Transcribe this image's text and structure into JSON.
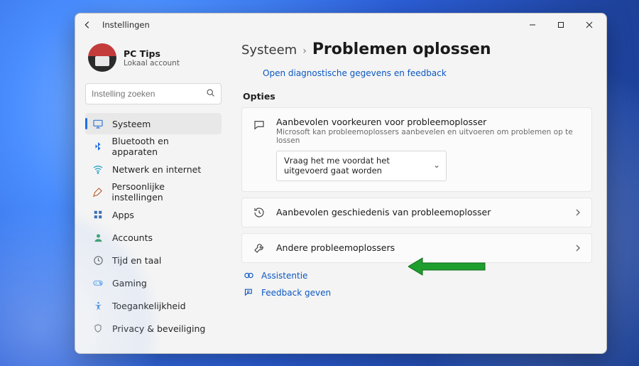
{
  "window": {
    "title": "Instellingen"
  },
  "profile": {
    "name": "PC Tips",
    "sub": "Lokaal account"
  },
  "search": {
    "placeholder": "Instelling zoeken"
  },
  "sidebar": {
    "items": [
      {
        "label": "Systeem",
        "icon": "system-icon",
        "color": "#3478d6",
        "active": true
      },
      {
        "label": "Bluetooth en apparaten",
        "icon": "bluetooth-icon",
        "color": "#1f6fe0"
      },
      {
        "label": "Netwerk en internet",
        "icon": "wifi-icon",
        "color": "#2aa3c9"
      },
      {
        "label": "Persoonlijke instellingen",
        "icon": "personalize-icon",
        "color": "#b35e2e"
      },
      {
        "label": "Apps",
        "icon": "apps-icon",
        "color": "#3a6fb5"
      },
      {
        "label": "Accounts",
        "icon": "accounts-icon",
        "color": "#3ea06a"
      },
      {
        "label": "Tijd en taal",
        "icon": "time-lang-icon",
        "color": "#5a5a5a"
      },
      {
        "label": "Gaming",
        "icon": "gaming-icon",
        "color": "#5aa3e8"
      },
      {
        "label": "Toegankelijkheid",
        "icon": "accessibility-icon",
        "color": "#2f7fe0"
      },
      {
        "label": "Privacy & beveiliging",
        "icon": "privacy-icon",
        "color": "#6a6a6a"
      }
    ]
  },
  "main": {
    "breadcrumb": {
      "parent": "Systeem",
      "title": "Problemen oplossen"
    },
    "diag_link": "Open diagnostische gegevens en feedback",
    "section_label": "Opties",
    "pref": {
      "title": "Aanbevolen voorkeuren voor probleemoplosser",
      "sub": "Microsoft kan probleemoplossers aanbevelen en uitvoeren om problemen op te lossen",
      "selected": "Vraag het me voordat het uitgevoerd gaat worden"
    },
    "history": {
      "title": "Aanbevolen geschiedenis van probleemoplosser"
    },
    "other": {
      "title": "Andere probleemoplossers"
    },
    "footer": {
      "assist": "Assistentie",
      "feedback": "Feedback geven"
    }
  }
}
